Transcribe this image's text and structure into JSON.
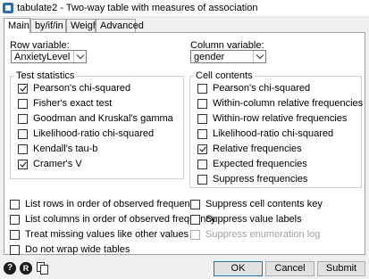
{
  "window": {
    "title": "tabulate2 - Two-way table with measures of association"
  },
  "tabs": [
    {
      "label": "Main"
    },
    {
      "label": "by/if/in"
    },
    {
      "label": "Weights"
    },
    {
      "label": "Advanced"
    }
  ],
  "row_variable": {
    "label": "Row variable:",
    "value": "AnxietyLevel"
  },
  "column_variable": {
    "label": "Column variable:",
    "value": "gender"
  },
  "test_statistics": {
    "title": "Test statistics",
    "items": [
      {
        "label": "Pearson's chi-squared",
        "checked": true
      },
      {
        "label": "Fisher's exact test",
        "checked": false
      },
      {
        "label": "Goodman and Kruskal's gamma",
        "checked": false
      },
      {
        "label": "Likelihood-ratio chi-squared",
        "checked": false
      },
      {
        "label": "Kendall's tau-b",
        "checked": false
      },
      {
        "label": "Cramer's V",
        "checked": true
      }
    ]
  },
  "cell_contents": {
    "title": "Cell contents",
    "items": [
      {
        "label": "Pearson's chi-squared",
        "checked": false
      },
      {
        "label": "Within-column relative frequencies",
        "checked": false
      },
      {
        "label": "Within-row relative frequencies",
        "checked": false
      },
      {
        "label": "Likelihood-ratio chi-squared",
        "checked": false
      },
      {
        "label": "Relative frequencies",
        "checked": true
      },
      {
        "label": "Expected frequencies",
        "checked": false
      },
      {
        "label": "Suppress frequencies",
        "checked": false
      }
    ]
  },
  "options_left": [
    {
      "label": "List rows in order of observed frequency",
      "checked": false
    },
    {
      "label": "List columns in order of observed frequency",
      "checked": false
    },
    {
      "label": "Treat missing values like other values",
      "checked": false
    },
    {
      "label": "Do not wrap wide tables",
      "checked": false
    }
  ],
  "options_right": [
    {
      "label": "Suppress cell contents key",
      "checked": false
    },
    {
      "label": "Suppress value labels",
      "checked": false
    },
    {
      "label": "Suppress enumeration log",
      "checked": false,
      "disabled": true
    }
  ],
  "footer": {
    "help_icon": "?",
    "reset_icon": "R",
    "ok_label": "OK",
    "cancel_label": "Cancel",
    "submit_label": "Submit"
  }
}
